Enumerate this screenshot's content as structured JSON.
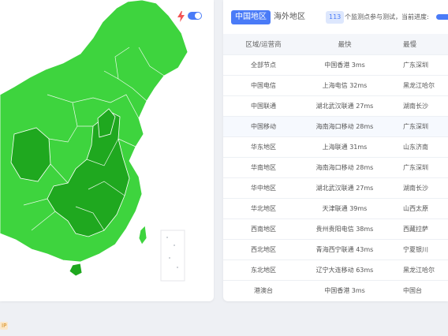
{
  "map": {
    "toggle_on": true,
    "colors": {
      "light": "#3ed43e",
      "dark": "#1fa81f",
      "border": "#ffffff"
    }
  },
  "tabs": {
    "china_label": "中国地区",
    "overseas_label": "海外地区"
  },
  "status": {
    "node_count": "113",
    "count_text": "个监测点参与测试，当前进度:",
    "progress_percent": 100
  },
  "table": {
    "headers": [
      "区域/运营商",
      "最快",
      "最慢"
    ],
    "rows": [
      [
        "全部节点",
        "中国香港 3ms",
        "广东深圳"
      ],
      [
        "中国电信",
        "上海电信 32ms",
        "黑龙江哈尔"
      ],
      [
        "中国联通",
        "湖北武汉联通 27ms",
        "湖南长沙"
      ],
      [
        "中国移动",
        "海南海口移动 28ms",
        "广东深圳"
      ],
      [
        "华东地区",
        "上海联通 31ms",
        "山东济南"
      ],
      [
        "华南地区",
        "海南海口移动 28ms",
        "广东深圳"
      ],
      [
        "华中地区",
        "湖北武汉联通 27ms",
        "湖南长沙"
      ],
      [
        "华北地区",
        "天津联通 39ms",
        "山西太原"
      ],
      [
        "西南地区",
        "贵州贵阳电信 38ms",
        "西藏拉萨"
      ],
      [
        "西北地区",
        "青海西宁联通 43ms",
        "宁夏银川"
      ],
      [
        "东北地区",
        "辽宁大连移动 63ms",
        "黑龙江哈尔"
      ],
      [
        "港澳台",
        "中国香港 3ms",
        "中国台"
      ]
    ],
    "highlight_row": 3
  },
  "footer": {
    "badge_label": "IP"
  }
}
